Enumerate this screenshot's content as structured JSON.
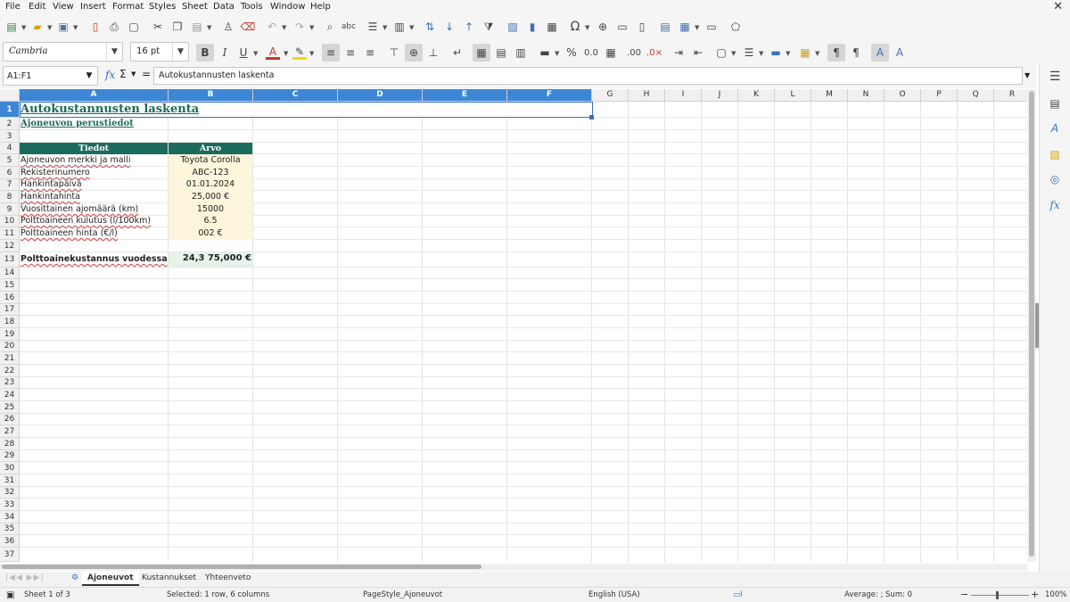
{
  "menu": [
    "File",
    "Edit",
    "View",
    "Insert",
    "Format",
    "Styles",
    "Sheet",
    "Data",
    "Tools",
    "Window",
    "Help"
  ],
  "font": {
    "name": "Cambria",
    "size": "16 pt"
  },
  "cell_ref": "A1:F1",
  "formula_content": "Autokustannusten laskenta",
  "columns": [
    "A",
    "B",
    "C",
    "D",
    "E",
    "F",
    "G",
    "H",
    "I",
    "J",
    "K",
    "L",
    "M",
    "N",
    "O",
    "P",
    "Q",
    "R"
  ],
  "rows": [
    "1",
    "2",
    "3",
    "4",
    "5",
    "6",
    "7",
    "8",
    "9",
    "10",
    "11",
    "12",
    "13",
    "14",
    "15",
    "16",
    "17",
    "18",
    "19",
    "20",
    "21",
    "22",
    "23",
    "24",
    "25",
    "26",
    "27",
    "28",
    "29",
    "30",
    "31",
    "32",
    "33",
    "34",
    "35",
    "36",
    "37"
  ],
  "sheet": {
    "title": "Autokustannusten laskenta",
    "subtitle": "Ajoneuvon perustiedot",
    "table_header": {
      "col_a": "Tiedot",
      "col_b": "Arvo"
    },
    "data_rows": [
      {
        "label": "Ajoneuvon merkki ja malli",
        "value": "Toyota Corolla"
      },
      {
        "label": "Rekisterinumero",
        "value": "ABC-123"
      },
      {
        "label": "Hankintapäivä",
        "value": "01.01.2024"
      },
      {
        "label": "Hankintahinta",
        "value": "25,000 €"
      },
      {
        "label": "Vuosittainen ajomäärä (km)",
        "value": "15000"
      },
      {
        "label": "Polttoaineen kulutus (l/100km)",
        "value": "6.5"
      },
      {
        "label": "Polttoaineen hinta (€/l)",
        "value": "002 €"
      }
    ],
    "total": {
      "label": "Polttoainekustannus vuodessa",
      "value": "24,3 75,000 €"
    }
  },
  "tabs": [
    "Ajoneuvot",
    "Kustannukset",
    "Yhteenveto"
  ],
  "active_tab": "Ajoneuvot",
  "status": {
    "sheet_info": "Sheet 1 of 3",
    "selection": "Selected: 1 row, 6 columns",
    "page_style": "PageStyle_Ajoneuvot",
    "language": "English (USA)",
    "summary": "Average: ; Sum: 0",
    "zoom": "100%"
  },
  "colors": {
    "accent_teal": "#1b6b5c",
    "selection_blue": "#3d86d6",
    "value_bg": "#fdf6dc"
  }
}
